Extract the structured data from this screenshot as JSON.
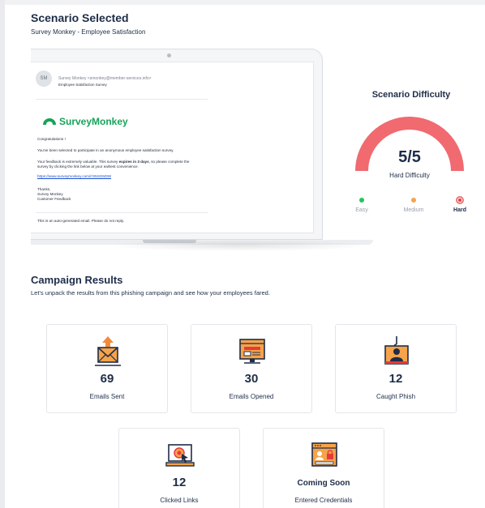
{
  "header": {
    "title": "Scenario Selected",
    "scenario": "Survey Monkey - Employee Satisfaction"
  },
  "email": {
    "avatar": "SM",
    "from": "Survey Monkey <smonkey@member-services.info>",
    "subject": "Employee Satisfaction Survey",
    "brand": "SurveyMonkey",
    "greeting": "Congratulations     !",
    "line1": "You've been selected to participate in an anonymous employee satisfaction survey.",
    "line2a": "Your feedback is extremely valuable.  This survey ",
    "line2b": "expires in 3 days",
    "line2c": ", so please complete the",
    "line3": "survey by clicking the link below at your earliest convenience.",
    "link": "https://www.surveymonkey.com/r/X5SGM3W",
    "sign1": "Thanks,",
    "sign2": "Survey Monkey",
    "sign3": "Customer Feedback",
    "footer": "This is an auto-generated email.  Please do not reply."
  },
  "difficulty": {
    "title": "Scenario Difficulty",
    "score": "5/5",
    "label": "Hard Difficulty",
    "level_value": 5,
    "level_max": 5,
    "levels": [
      "Easy",
      "Medium",
      "Hard"
    ],
    "colors": {
      "easy": "#22c55e",
      "medium": "#f6a34a",
      "hard": "#e53b3b",
      "gauge": "#f06a70"
    }
  },
  "campaign": {
    "title": "Campaign Results",
    "description": "Let's unpack the results from this phishing campaign and see how your employees fared.",
    "cards": [
      {
        "value": "69",
        "label": "Emails Sent",
        "icon": "envelope-upload-icon"
      },
      {
        "value": "30",
        "label": "Emails Opened",
        "icon": "open-email-monitor-icon"
      },
      {
        "value": "12",
        "label": "Caught Phish",
        "icon": "hooked-user-icon"
      },
      {
        "value": "12",
        "label": "Clicked Links",
        "icon": "laptop-click-icon"
      },
      {
        "value": "Coming Soon",
        "label": "Entered Credentials",
        "icon": "credentials-lock-icon"
      }
    ]
  }
}
